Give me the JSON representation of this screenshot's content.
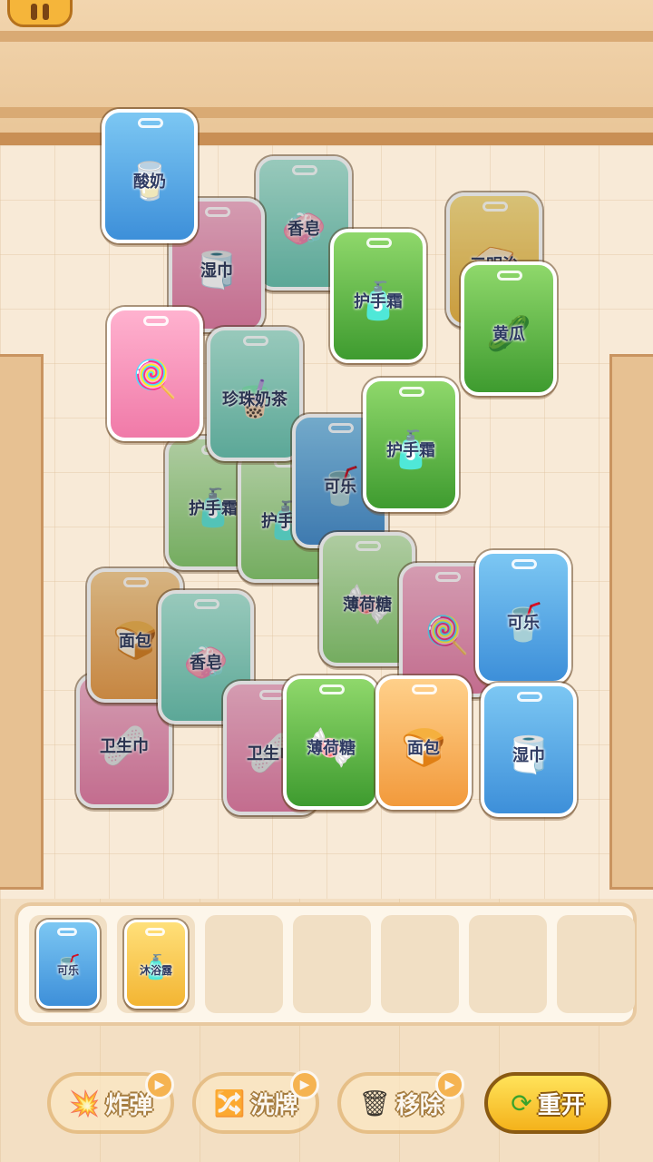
{
  "colors": {
    "accent": "#f4b21b",
    "tray_bg": "#fdf6ea",
    "floor": "#f3dfc3"
  },
  "board": {
    "tiles": [
      {
        "label": "酸奶",
        "icon": "yogurt-icon",
        "color": "blue"
      },
      {
        "label": "香皂",
        "icon": "soap-icon",
        "color": "mint"
      },
      {
        "label": "湿巾",
        "icon": "wet-wipes-icon",
        "color": "pink"
      },
      {
        "label": "三明治",
        "icon": "sandwich-icon",
        "color": "yellow"
      },
      {
        "label": "护手霜",
        "icon": "hand-cream-icon",
        "color": "green"
      },
      {
        "label": "黄瓜",
        "icon": "cucumber-icon",
        "color": "green"
      },
      {
        "label": "",
        "icon": "lollipop-icon",
        "color": "pink"
      },
      {
        "label": "珍珠奶茶",
        "icon": "bubble-tea-icon",
        "color": "mint"
      },
      {
        "label": "护手霜",
        "icon": "hand-cream-icon",
        "color": "green"
      },
      {
        "label": "可乐",
        "icon": "cola-icon",
        "color": "blue"
      },
      {
        "label": "护手霜",
        "icon": "hand-cream-icon",
        "color": "lgreen"
      },
      {
        "label": "护手霜",
        "icon": "hand-cream-icon",
        "color": "lgreen"
      },
      {
        "label": "薄荷糖",
        "icon": "mint-candy-icon",
        "color": "lgreen"
      },
      {
        "label": "",
        "icon": "lollipop-icon",
        "color": "pink"
      },
      {
        "label": "可乐",
        "icon": "cola-icon",
        "color": "blue"
      },
      {
        "label": "面包",
        "icon": "bread-icon",
        "color": "orange"
      },
      {
        "label": "香皂",
        "icon": "soap-icon",
        "color": "mint"
      },
      {
        "label": "卫生巾",
        "icon": "pad-icon",
        "color": "pink"
      },
      {
        "label": "卫生巾",
        "icon": "pad-icon",
        "color": "pink"
      },
      {
        "label": "薄荷糖",
        "icon": "mint-candy-icon",
        "color": "green"
      },
      {
        "label": "面包",
        "icon": "bread-icon",
        "color": "orange"
      },
      {
        "label": "湿巾",
        "icon": "wet-wipes-icon",
        "color": "blue"
      }
    ]
  },
  "tray": {
    "slot_count": 7,
    "items": [
      {
        "label": "可乐",
        "icon": "cola-icon",
        "color": "blue"
      },
      {
        "label": "沐浴露",
        "icon": "body-wash-icon",
        "color": "yellow"
      }
    ]
  },
  "toolbar": {
    "bomb": {
      "label": "炸弹",
      "icon": "bomb-icon"
    },
    "shuffle": {
      "label": "洗牌",
      "icon": "shuffle-icon"
    },
    "remove": {
      "label": "移除",
      "icon": "bin-icon"
    },
    "restart": {
      "label": "重开",
      "icon": "restart-icon"
    }
  }
}
